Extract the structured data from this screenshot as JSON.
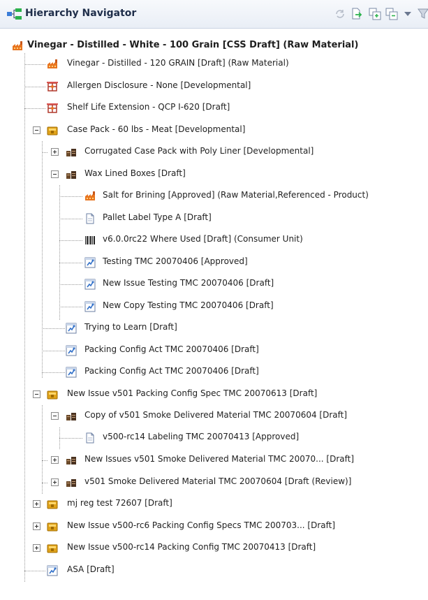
{
  "header": {
    "title": "Hierarchy Navigator",
    "toolbar": [
      "refresh-icon",
      "export-icon",
      "expand-all-icon",
      "collapse-all-icon",
      "dropdown-icon",
      "filter-icon"
    ]
  },
  "tree": {
    "root": "Vinegar - Distilled - White - 100 Grain [CSS Draft] (Raw Material)",
    "n1": "Vinegar - Distilled - 120 GRAIN [Draft] (Raw Material)",
    "n2": "Allergen Disclosure - None [Developmental]",
    "n3": "Shelf Life Extension - QCP I-620 [Draft]",
    "n4": "Case Pack - 60 lbs - Meat [Developmental]",
    "n5": "Corrugated Case Pack with Poly Liner [Developmental]",
    "n6": "Wax Lined Boxes [Draft]",
    "n7": "Salt for Brining [Approved] (Raw Material,Referenced - Product)",
    "n8": "Pallet Label Type A [Draft]",
    "n9": "v6.0.0rc22 Where Used [Draft] (Consumer Unit)",
    "n10": "Testing TMC 20070406 [Approved]",
    "n11": "New Issue Testing TMC 20070406 [Draft]",
    "n12": "New Copy Testing TMC 20070406 [Draft]",
    "n13": "Trying to Learn [Draft]",
    "n14": "Packing Config Act TMC 20070406 [Draft]",
    "n15": "Packing Config Act TMC 20070406 [Draft]",
    "n16": "New Issue v501 Packing Config Spec TMC 20070613 [Draft]",
    "n17": "Copy of v501 Smoke Delivered Material TMC 20070604 [Draft]",
    "n18": "v500-rc14 Labeling TMC 20070413 [Approved]",
    "n19": "New Issues v501 Smoke Delivered Material TMC 20070... [Draft]",
    "n20": "v501 Smoke Delivered Material TMC 20070604 [Draft (Review)]",
    "n21": "mj reg test 72607 [Draft]",
    "n22": "New Issue v500-rc6 Packing Config Specs TMC 200703... [Draft]",
    "n23": "New Issue v500-rc14 Packing Config TMC 20070413 [Draft]",
    "n24": "ASA [Draft]"
  }
}
